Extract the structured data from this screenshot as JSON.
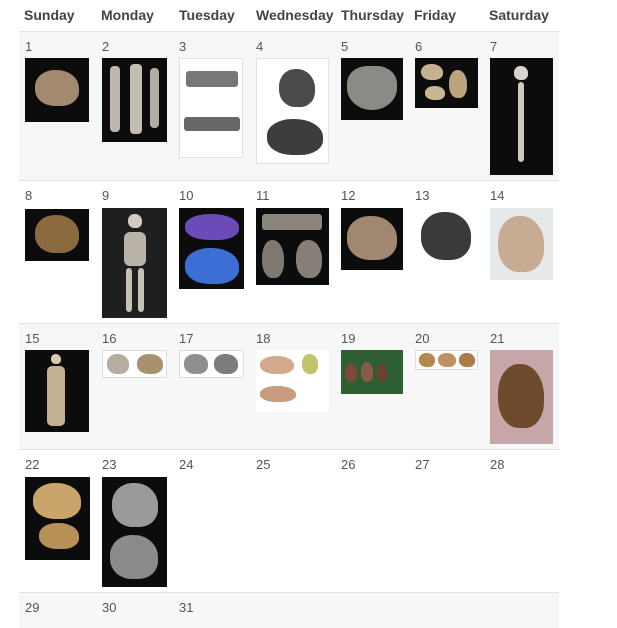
{
  "headers": [
    "Sunday",
    "Monday",
    "Tuesday",
    "Wednesday",
    "Thursday",
    "Friday",
    "Saturday"
  ],
  "weeks": [
    [
      "1",
      "2",
      "3",
      "4",
      "5",
      "6",
      "7"
    ],
    [
      "8",
      "9",
      "10",
      "11",
      "12",
      "13",
      "14"
    ],
    [
      "15",
      "16",
      "17",
      "18",
      "19",
      "20",
      "21"
    ],
    [
      "22",
      "23",
      "24",
      "25",
      "26",
      "27",
      "28"
    ],
    [
      "29",
      "30",
      "31",
      "",
      "",
      "",
      ""
    ]
  ],
  "thumbnails": [
    {
      "day": "1",
      "icon": "skull-photo-icon"
    },
    {
      "day": "2",
      "icon": "bones-photo-icon"
    },
    {
      "day": "3",
      "icon": "bone-drawing-icon"
    },
    {
      "day": "4",
      "icon": "skull-views-icon"
    },
    {
      "day": "5",
      "icon": "jaw-photo-icon"
    },
    {
      "day": "6",
      "icon": "fragments-photo-icon"
    },
    {
      "day": "7",
      "icon": "skeleton-photo-icon"
    },
    {
      "day": "8",
      "icon": "skull-photo-icon"
    },
    {
      "day": "9",
      "icon": "skeleton-photo-icon"
    },
    {
      "day": "10",
      "icon": "skull-scan-icon"
    },
    {
      "day": "11",
      "icon": "jaw-fragments-icon"
    },
    {
      "day": "12",
      "icon": "skull-photo-icon"
    },
    {
      "day": "13",
      "icon": "skull-drawing-icon"
    },
    {
      "day": "14",
      "icon": "skull-photo-icon"
    },
    {
      "day": "15",
      "icon": "skeleton-photo-icon"
    },
    {
      "day": "16",
      "icon": "skulls-pair-icon"
    },
    {
      "day": "17",
      "icon": "skulls-pair-icon"
    },
    {
      "day": "18",
      "icon": "jaw-fragments-icon"
    },
    {
      "day": "19",
      "icon": "teeth-photo-icon"
    },
    {
      "day": "20",
      "icon": "skulls-row-icon"
    },
    {
      "day": "21",
      "icon": "skull-photo-icon"
    },
    {
      "day": "22",
      "icon": "skull-photo-icon"
    },
    {
      "day": "23",
      "icon": "skull-views-icon"
    }
  ]
}
